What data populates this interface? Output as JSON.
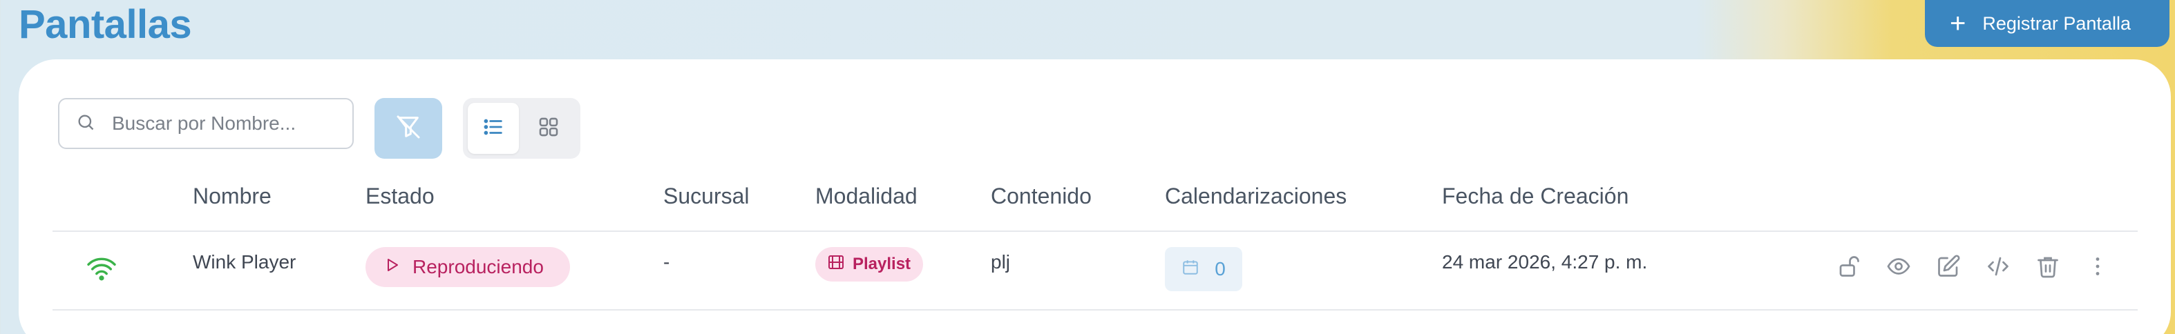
{
  "page": {
    "title": "Pantallas"
  },
  "header": {
    "register_label": "Registrar Pantalla",
    "register_icon": "plus-icon"
  },
  "toolbar": {
    "search_placeholder": "Buscar por Nombre...",
    "filter_icon": "filter-off-icon",
    "view_options": [
      "list-view",
      "grid-view"
    ],
    "active_view": "list-view"
  },
  "table": {
    "columns": [
      "Nombre",
      "Estado",
      "Sucursal",
      "Modalidad",
      "Contenido",
      "Calendarizaciones",
      "Fecha de Creación"
    ],
    "rows": [
      {
        "connection_icon": "wifi-icon",
        "nombre": "Wink Player",
        "estado": "Reproduciendo",
        "sucursal": "-",
        "modalidad": "Playlist",
        "contenido": "plj",
        "calendarizaciones": "0",
        "fecha": "24 mar 2026, 4:27 p. m.",
        "actions": [
          "unlock-icon",
          "eye-icon",
          "edit-icon",
          "code-icon",
          "trash-icon",
          "more-vertical-icon"
        ]
      }
    ]
  },
  "colors": {
    "accent": "#3a86c0",
    "title": "#3d8ec9",
    "status_bg": "#fbe0ec",
    "status_text": "#b8215f",
    "online": "#3bb34a"
  }
}
